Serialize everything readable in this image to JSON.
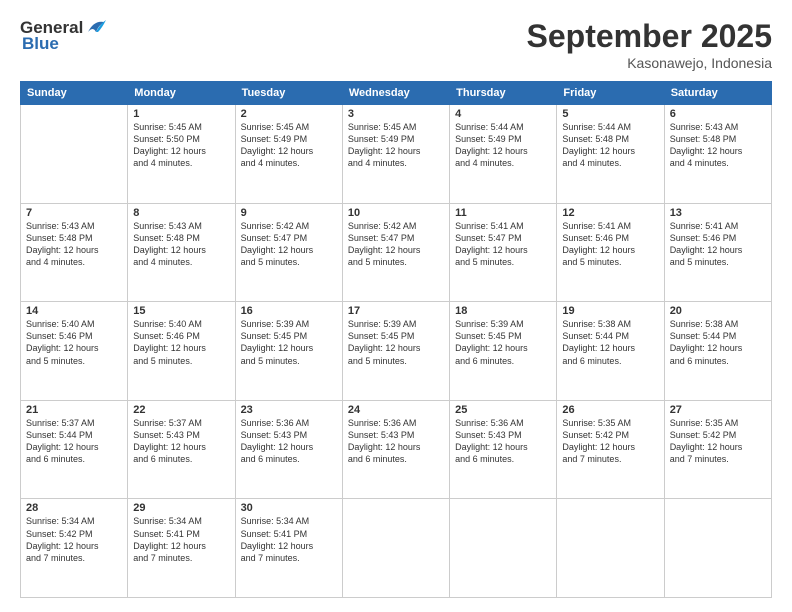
{
  "logo": {
    "general": "General",
    "blue": "Blue"
  },
  "header": {
    "month": "September 2025",
    "location": "Kasonawejo, Indonesia"
  },
  "weekdays": [
    "Sunday",
    "Monday",
    "Tuesday",
    "Wednesday",
    "Thursday",
    "Friday",
    "Saturday"
  ],
  "weeks": [
    [
      {
        "day": "",
        "detail": ""
      },
      {
        "day": "1",
        "detail": "Sunrise: 5:45 AM\nSunset: 5:50 PM\nDaylight: 12 hours\nand 4 minutes."
      },
      {
        "day": "2",
        "detail": "Sunrise: 5:45 AM\nSunset: 5:49 PM\nDaylight: 12 hours\nand 4 minutes."
      },
      {
        "day": "3",
        "detail": "Sunrise: 5:45 AM\nSunset: 5:49 PM\nDaylight: 12 hours\nand 4 minutes."
      },
      {
        "day": "4",
        "detail": "Sunrise: 5:44 AM\nSunset: 5:49 PM\nDaylight: 12 hours\nand 4 minutes."
      },
      {
        "day": "5",
        "detail": "Sunrise: 5:44 AM\nSunset: 5:48 PM\nDaylight: 12 hours\nand 4 minutes."
      },
      {
        "day": "6",
        "detail": "Sunrise: 5:43 AM\nSunset: 5:48 PM\nDaylight: 12 hours\nand 4 minutes."
      }
    ],
    [
      {
        "day": "7",
        "detail": "Sunrise: 5:43 AM\nSunset: 5:48 PM\nDaylight: 12 hours\nand 4 minutes."
      },
      {
        "day": "8",
        "detail": "Sunrise: 5:43 AM\nSunset: 5:48 PM\nDaylight: 12 hours\nand 4 minutes."
      },
      {
        "day": "9",
        "detail": "Sunrise: 5:42 AM\nSunset: 5:47 PM\nDaylight: 12 hours\nand 5 minutes."
      },
      {
        "day": "10",
        "detail": "Sunrise: 5:42 AM\nSunset: 5:47 PM\nDaylight: 12 hours\nand 5 minutes."
      },
      {
        "day": "11",
        "detail": "Sunrise: 5:41 AM\nSunset: 5:47 PM\nDaylight: 12 hours\nand 5 minutes."
      },
      {
        "day": "12",
        "detail": "Sunrise: 5:41 AM\nSunset: 5:46 PM\nDaylight: 12 hours\nand 5 minutes."
      },
      {
        "day": "13",
        "detail": "Sunrise: 5:41 AM\nSunset: 5:46 PM\nDaylight: 12 hours\nand 5 minutes."
      }
    ],
    [
      {
        "day": "14",
        "detail": "Sunrise: 5:40 AM\nSunset: 5:46 PM\nDaylight: 12 hours\nand 5 minutes."
      },
      {
        "day": "15",
        "detail": "Sunrise: 5:40 AM\nSunset: 5:46 PM\nDaylight: 12 hours\nand 5 minutes."
      },
      {
        "day": "16",
        "detail": "Sunrise: 5:39 AM\nSunset: 5:45 PM\nDaylight: 12 hours\nand 5 minutes."
      },
      {
        "day": "17",
        "detail": "Sunrise: 5:39 AM\nSunset: 5:45 PM\nDaylight: 12 hours\nand 5 minutes."
      },
      {
        "day": "18",
        "detail": "Sunrise: 5:39 AM\nSunset: 5:45 PM\nDaylight: 12 hours\nand 6 minutes."
      },
      {
        "day": "19",
        "detail": "Sunrise: 5:38 AM\nSunset: 5:44 PM\nDaylight: 12 hours\nand 6 minutes."
      },
      {
        "day": "20",
        "detail": "Sunrise: 5:38 AM\nSunset: 5:44 PM\nDaylight: 12 hours\nand 6 minutes."
      }
    ],
    [
      {
        "day": "21",
        "detail": "Sunrise: 5:37 AM\nSunset: 5:44 PM\nDaylight: 12 hours\nand 6 minutes."
      },
      {
        "day": "22",
        "detail": "Sunrise: 5:37 AM\nSunset: 5:43 PM\nDaylight: 12 hours\nand 6 minutes."
      },
      {
        "day": "23",
        "detail": "Sunrise: 5:36 AM\nSunset: 5:43 PM\nDaylight: 12 hours\nand 6 minutes."
      },
      {
        "day": "24",
        "detail": "Sunrise: 5:36 AM\nSunset: 5:43 PM\nDaylight: 12 hours\nand 6 minutes."
      },
      {
        "day": "25",
        "detail": "Sunrise: 5:36 AM\nSunset: 5:43 PM\nDaylight: 12 hours\nand 6 minutes."
      },
      {
        "day": "26",
        "detail": "Sunrise: 5:35 AM\nSunset: 5:42 PM\nDaylight: 12 hours\nand 7 minutes."
      },
      {
        "day": "27",
        "detail": "Sunrise: 5:35 AM\nSunset: 5:42 PM\nDaylight: 12 hours\nand 7 minutes."
      }
    ],
    [
      {
        "day": "28",
        "detail": "Sunrise: 5:34 AM\nSunset: 5:42 PM\nDaylight: 12 hours\nand 7 minutes."
      },
      {
        "day": "29",
        "detail": "Sunrise: 5:34 AM\nSunset: 5:41 PM\nDaylight: 12 hours\nand 7 minutes."
      },
      {
        "day": "30",
        "detail": "Sunrise: 5:34 AM\nSunset: 5:41 PM\nDaylight: 12 hours\nand 7 minutes."
      },
      {
        "day": "",
        "detail": ""
      },
      {
        "day": "",
        "detail": ""
      },
      {
        "day": "",
        "detail": ""
      },
      {
        "day": "",
        "detail": ""
      }
    ]
  ]
}
